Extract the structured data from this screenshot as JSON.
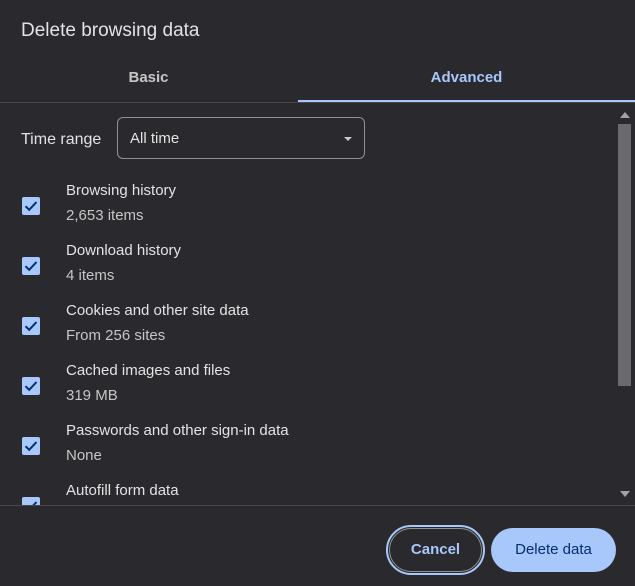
{
  "dialog": {
    "title": "Delete browsing data"
  },
  "tabs": [
    {
      "label": "Basic",
      "active": false
    },
    {
      "label": "Advanced",
      "active": true
    }
  ],
  "time_range": {
    "label": "Time range",
    "value": "All time"
  },
  "items": [
    {
      "title": "Browsing history",
      "subtitle": "2,653 items",
      "checked": true
    },
    {
      "title": "Download history",
      "subtitle": "4 items",
      "checked": true
    },
    {
      "title": "Cookies and other site data",
      "subtitle": "From 256 sites",
      "checked": true
    },
    {
      "title": "Cached images and files",
      "subtitle": "319 MB",
      "checked": true
    },
    {
      "title": "Passwords and other sign-in data",
      "subtitle": "None",
      "checked": true
    },
    {
      "title": "Autofill form data",
      "subtitle": "",
      "checked": true
    }
  ],
  "footer": {
    "cancel_label": "Cancel",
    "delete_label": "Delete data"
  },
  "colors": {
    "background": "#2a2a2e",
    "accent": "#a8c7fa",
    "text": "#e3e3e3"
  }
}
